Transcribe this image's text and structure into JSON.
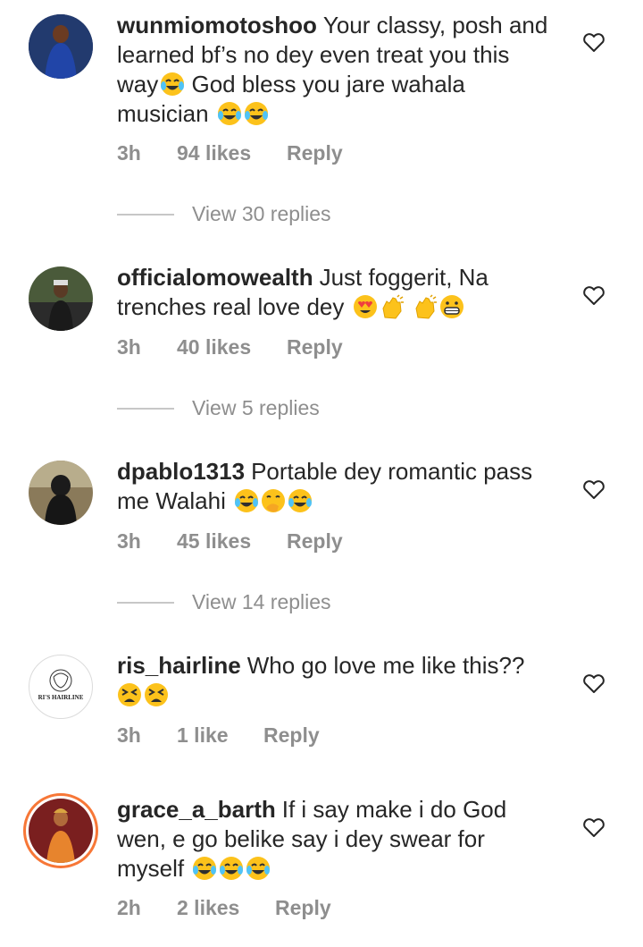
{
  "comments": [
    {
      "username": "wunmiomotoshoo",
      "text": "Your classy, posh and learned bf’s no dey even treat you this way",
      "text2": "God bless you jare wahala musician",
      "time": "3h",
      "likes": "94 likes",
      "reply": "Reply",
      "view_replies": "View 30 replies",
      "avatar_icon": "woman-blue-dress-avatar"
    },
    {
      "username": "officialomowealth",
      "text": "Just foggerit, Na trenches real love dey",
      "time": "3h",
      "likes": "40 likes",
      "reply": "Reply",
      "view_replies": "View 5 replies",
      "avatar_icon": "man-cap-avatar"
    },
    {
      "username": "dpablo1313",
      "text": "Portable dey romantic pass me Walahi",
      "time": "3h",
      "likes": "45 likes",
      "reply": "Reply",
      "view_replies": "View 14 replies",
      "avatar_icon": "hooded-man-avatar"
    },
    {
      "username": "ris_hairline",
      "text": "Who go love me like this??",
      "time": "3h",
      "likes": "1 like",
      "reply": "Reply",
      "avatar_icon": "ris-hairline-logo-avatar",
      "logo_text": "RI'S HAIRLINE"
    },
    {
      "username": "grace_a_barth",
      "text": "If i say make i do God wen, e go belike say i dey swear for myself",
      "time": "2h",
      "likes": "2 likes",
      "reply": "Reply",
      "avatar_icon": "woman-orange-outfit-avatar"
    }
  ],
  "colors": {
    "text": "#262626",
    "secondary": "#8e8e8e",
    "story_ring": "#e1306c"
  }
}
